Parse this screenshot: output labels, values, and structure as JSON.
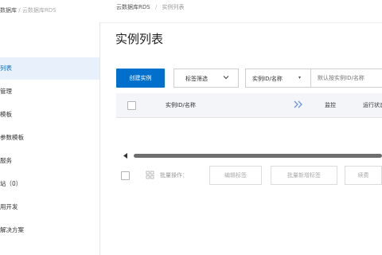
{
  "topbar": {
    "left_crumb": "数据库",
    "left_sep": "/",
    "left_sub": "云数据库RDS",
    "product": "云数据库RDS",
    "sep": "/",
    "current": "实例列表"
  },
  "sidebar": {
    "items": [
      {
        "label": "列表",
        "active": true
      },
      {
        "label": "管理"
      },
      {
        "label": "模板"
      },
      {
        "label": "参数模板"
      },
      {
        "label": "服务"
      },
      {
        "label": "站（0）"
      },
      {
        "label": "用开发"
      },
      {
        "label": "解决方案"
      }
    ]
  },
  "page": {
    "title": "实例列表"
  },
  "toolbar": {
    "create_label": "创建实例",
    "tag_filter_label": "标签筛选",
    "search_field_label": "实例ID/名称",
    "search_placeholder": "默认按实例ID/名称"
  },
  "table": {
    "headers": [
      "实例ID/名称",
      "监控",
      "运行状态"
    ]
  },
  "batch": {
    "label": "批量操作：",
    "buttons": [
      "编辑标签",
      "批量新增标签",
      "续费"
    ]
  },
  "colors": {
    "accent": "#0070cc",
    "active_bg": "#e8f1fb",
    "header_bg": "#f3f5f8"
  }
}
